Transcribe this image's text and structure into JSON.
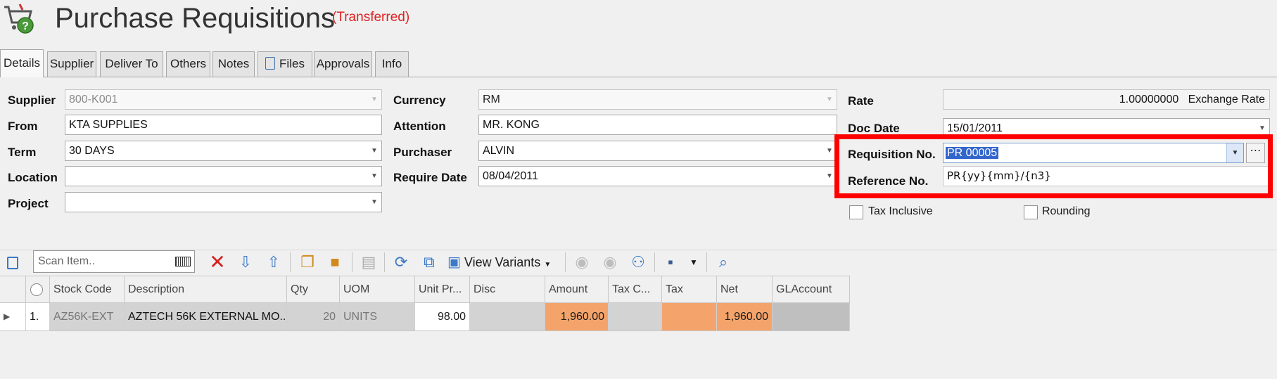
{
  "header": {
    "title": "Purchase Requisitions",
    "status": "(Transferred)"
  },
  "tabs": [
    {
      "label": "Details",
      "active": true
    },
    {
      "label": "Supplier"
    },
    {
      "label": "Deliver To"
    },
    {
      "label": "Others"
    },
    {
      "label": "Notes"
    },
    {
      "label": "Files",
      "icon": "attachment-icon"
    },
    {
      "label": "Approvals"
    },
    {
      "label": "Info"
    }
  ],
  "form": {
    "supplier": {
      "label": "Supplier",
      "value": "800-K001"
    },
    "from": {
      "label": "From",
      "value": "KTA SUPPLIES"
    },
    "term": {
      "label": "Term",
      "value": "30 DAYS"
    },
    "location": {
      "label": "Location",
      "value": ""
    },
    "project": {
      "label": "Project",
      "value": ""
    },
    "currency": {
      "label": "Currency",
      "value": "RM"
    },
    "attention": {
      "label": "Attention",
      "value": "MR. KONG"
    },
    "purchaser": {
      "label": "Purchaser",
      "value": "ALVIN"
    },
    "require_date": {
      "label": "Require Date",
      "value": "08/04/2011"
    },
    "rate": {
      "label": "Rate",
      "value": "1.00000000",
      "suffix": "Exchange Rate"
    },
    "doc_date": {
      "label": "Doc Date",
      "value": "15/01/2011"
    },
    "requisition_no": {
      "label": "Requisition No.",
      "value": "PR 00005"
    },
    "reference_no": {
      "label": "Reference No.",
      "value": "PR{yy}{mm}/{n3}"
    },
    "tax_inclusive": {
      "label": "Tax Inclusive",
      "checked": false
    },
    "rounding": {
      "label": "Rounding",
      "checked": false
    }
  },
  "toolbar": {
    "scan_placeholder": "Scan Item..",
    "view_variants_label": "View Variants"
  },
  "grid": {
    "columns": [
      "Stock Code",
      "Description",
      "Qty",
      "UOM",
      "Unit Pr...",
      "Disc",
      "Amount",
      "Tax C...",
      "Tax",
      "Net",
      "GLAccount"
    ],
    "rows": [
      {
        "no": "1.",
        "stock_code": "AZ56K-EXT",
        "description": "AZTECH 56K EXTERNAL MO...",
        "qty": "20",
        "uom": "UNITS",
        "unit_price": "98.00",
        "disc": "",
        "amount": "1,960.00",
        "tax_code": "",
        "tax": "",
        "net": "1,960.00",
        "gl_account": ""
      }
    ]
  },
  "colors": {
    "highlight": "#ff0000",
    "status": "#e02020",
    "amount_cell": "#f4a46a",
    "selection": "#3366cc"
  }
}
